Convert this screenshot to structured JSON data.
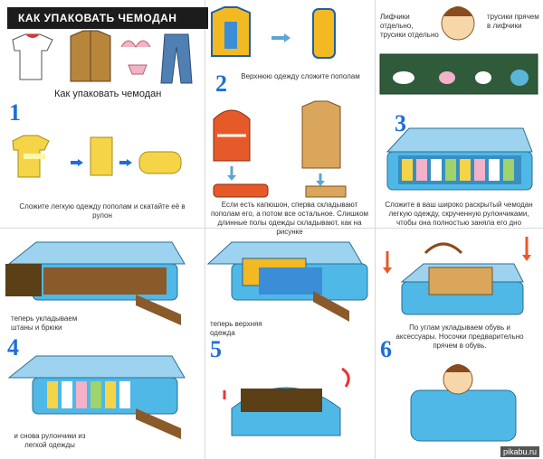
{
  "header": {
    "title": "КАК УПАКОВАТЬ ЧЕМОДАН",
    "subtitle": "Как упаковать чемодан"
  },
  "steps": {
    "s1": {
      "number": "1",
      "caption": "Сложите легкую одежду пополам и скатайте её в рулон"
    },
    "s2": {
      "number": "2",
      "caption_top": "Верхнюю одежду сложите пополам",
      "caption_bottom": "Если есть капюшон, сперва складывают пополам его, а потом все остальное. Слишком длинные полы одежды складывают, как на рисунке"
    },
    "s3": {
      "number": "3",
      "bubble_left": "Лифчики отдельно, трусики отдельно",
      "bubble_right": "трусики прячем в лифчики",
      "caption": "Сложите в ваш широко раскрытый чемодан легкую одежду, скрученную рулончиками, чтобы она полностью заняла его дно"
    },
    "s4": {
      "number": "4",
      "caption_top": "теперь укладываем штаны и брюки",
      "caption_bottom": "и снова рулончики из легкой одежды"
    },
    "s5": {
      "number": "5",
      "caption": "теперь верхняя одежда"
    },
    "s6": {
      "number": "6",
      "caption": "По углам укладываем обувь и аксессуары. Носочки предварительно прячем в обувь."
    }
  },
  "watermark": "pikabu.ru",
  "colors": {
    "accent": "#1e6fd6",
    "suitcase": "#4fb8e6",
    "shirt": "#f5d547",
    "jacket": "#e65a2a",
    "coat": "#d9a65c",
    "pants": "#8a5a2b"
  }
}
